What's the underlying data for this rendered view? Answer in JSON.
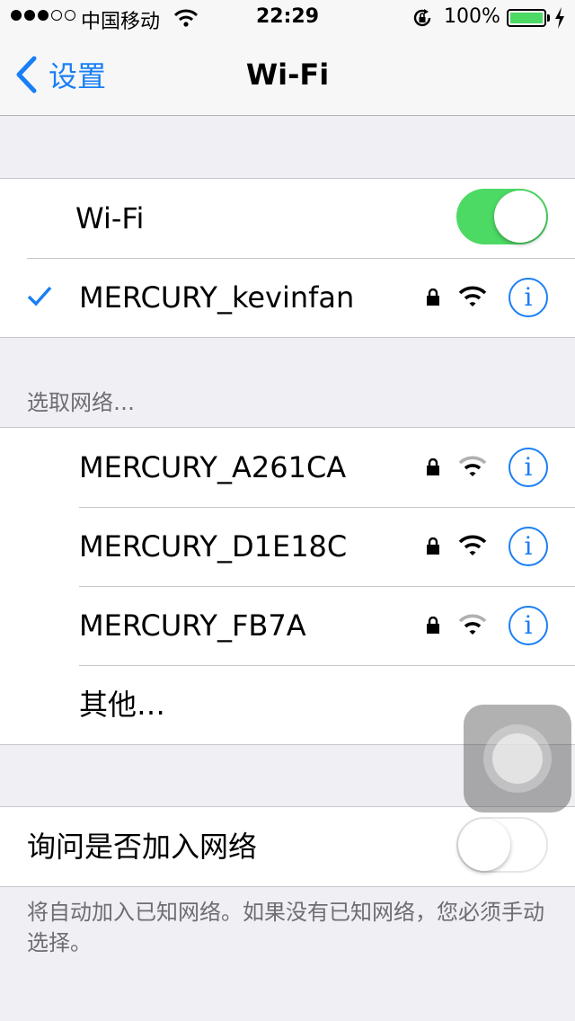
{
  "status_bar": {
    "signal_filled": 3,
    "signal_total": 5,
    "carrier": "中国移动",
    "time": "22:29",
    "battery_percent": "100%",
    "battery_level": 1.0,
    "battery_color": "#4cd964"
  },
  "nav": {
    "back_label": "设置",
    "title": "Wi-Fi",
    "accent": "#1a7ff5"
  },
  "wifi_group": {
    "toggle_label": "Wi-Fi",
    "toggle_on": true,
    "connected_network": "MERCURY_kevinfan"
  },
  "choose_network": {
    "header": "选取网络…",
    "networks": [
      {
        "name": "MERCURY_A261CA",
        "secured": true,
        "signal": "weak"
      },
      {
        "name": "MERCURY_D1E18C",
        "secured": true,
        "signal": "strong"
      },
      {
        "name": "MERCURY_FB7A",
        "secured": true,
        "signal": "weak"
      }
    ],
    "other_label": "其他…"
  },
  "ask_join": {
    "label": "询问是否加入网络",
    "toggle_on": false,
    "footer": "将自动加入已知网络。如果没有已知网络，您必须手动选择。"
  },
  "icons": {
    "info": "i"
  }
}
